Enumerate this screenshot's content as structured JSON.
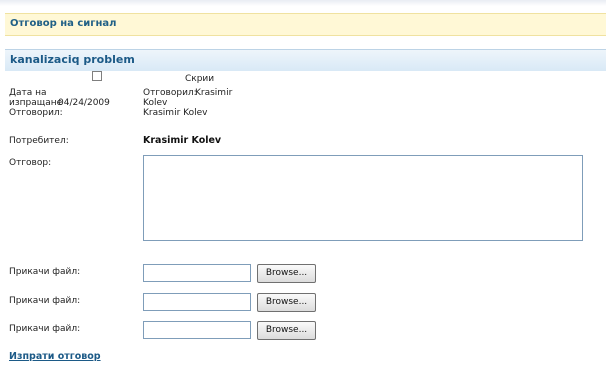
{
  "header": {
    "title": "Отговор на сигнал"
  },
  "section": {
    "title": "kanalizaciq problem"
  },
  "hide": {
    "label": "Скрии"
  },
  "meta": {
    "send_date_label_line1": "Дата на",
    "send_date_label_line2": "изпращане",
    "send_date_value": "04/24/2009",
    "answered_by_label": "Отговорил:",
    "answered_by_inline_label": "Отговорил:",
    "answered_by_inline_first": "Krasimir",
    "answered_by_inline_last": "Kolev",
    "answered_by_value": "Krasimir Kolev"
  },
  "user": {
    "label": "Потребител:",
    "value": "Krasimir Kolev"
  },
  "answer": {
    "label": "Отговор:",
    "value": ""
  },
  "attachments": [
    {
      "label": "Прикачи файл:",
      "button": "Browse..."
    },
    {
      "label": "Прикачи файл:",
      "button": "Browse..."
    },
    {
      "label": "Прикачи файл:",
      "button": "Browse..."
    }
  ],
  "send_link": "Изпрати отговор"
}
